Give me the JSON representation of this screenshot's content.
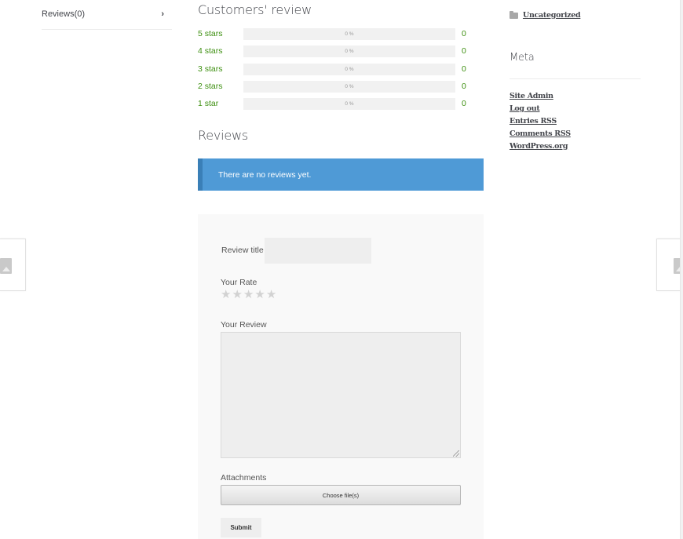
{
  "tabs": {
    "items": [
      {
        "label": "Reviews(0)",
        "icon": "chevron-right-icon"
      }
    ]
  },
  "customers_review": {
    "title": "Customers' review",
    "rows": [
      {
        "label": "5 stars",
        "percent_text": "0 %",
        "count": "0",
        "percent": 0
      },
      {
        "label": "4 stars",
        "percent_text": "0 %",
        "count": "0",
        "percent": 0
      },
      {
        "label": "3 stars",
        "percent_text": "0 %",
        "count": "0",
        "percent": 0
      },
      {
        "label": "2 stars",
        "percent_text": "0 %",
        "count": "0",
        "percent": 0
      },
      {
        "label": "1 star",
        "percent_text": "0 %",
        "count": "0",
        "percent": 0
      }
    ]
  },
  "reviews": {
    "title": "Reviews",
    "notice": "There are no reviews yet."
  },
  "form": {
    "review_title_label": "Review title",
    "review_title_value": "",
    "rate_label": "Your Rate",
    "stars": [
      "★",
      "★",
      "★",
      "★",
      "★"
    ],
    "review_label": "Your Review",
    "review_value": "",
    "attachments_label": "Attachments",
    "choose_files_label": "Choose file(s)",
    "submit_label": "Submit"
  },
  "sidebar": {
    "category_link": "Uncategorized",
    "meta_title": "Meta",
    "meta_links": [
      "Site Admin",
      "Log out",
      "Entries RSS",
      "Comments RSS",
      "WordPress.org"
    ]
  },
  "colors": {
    "accent_green": "#3d8f10",
    "notice_blue": "#4f9ad6",
    "notice_border": "#3a7fb7"
  }
}
